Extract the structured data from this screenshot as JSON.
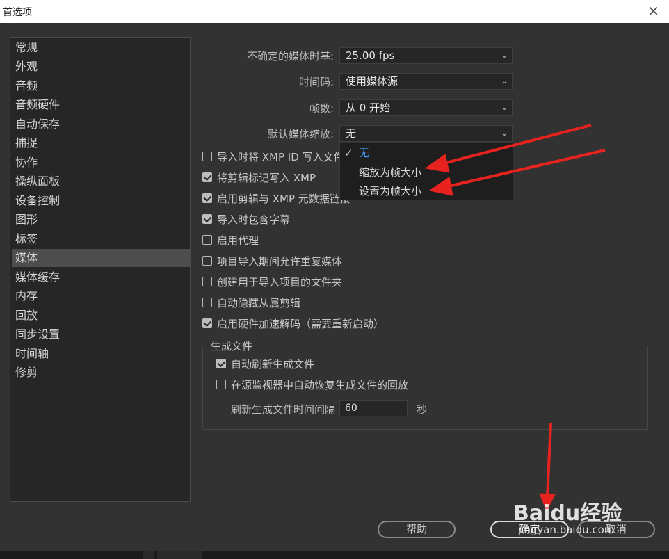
{
  "window": {
    "title": "首选项",
    "close_glyph": "✕"
  },
  "sidebar": {
    "items": [
      "常规",
      "外观",
      "音频",
      "音频硬件",
      "自动保存",
      "捕捉",
      "协作",
      "操纵面板",
      "设备控制",
      "图形",
      "标签",
      "媒体",
      "媒体缓存",
      "内存",
      "回放",
      "同步设置",
      "时间轴",
      "修剪"
    ],
    "selected": "媒体"
  },
  "media": {
    "timebase": {
      "label": "不确定的媒体时基:",
      "value": "25.00 fps"
    },
    "timecode": {
      "label": "时间码:",
      "value": "使用媒体源"
    },
    "frame_count": {
      "label": "帧数:",
      "value": "从 0 开始"
    },
    "default_scale": {
      "label": "默认媒体缩放:",
      "value": "无",
      "options": [
        "无",
        "缩放为帧大小",
        "设置为帧大小"
      ]
    },
    "checkboxes": [
      {
        "label": "导入时将 XMP ID 写入文件",
        "checked": false
      },
      {
        "label": "将剪辑标记写入 XMP",
        "checked": true
      },
      {
        "label": "启用剪辑与 XMP 元数据链接",
        "checked": true
      },
      {
        "label": "导入时包含字幕",
        "checked": true
      },
      {
        "label": "启用代理",
        "checked": false
      },
      {
        "label": "项目导入期间允许重复媒体",
        "checked": false
      },
      {
        "label": "创建用于导入项目的文件夹",
        "checked": false
      },
      {
        "label": "自动隐藏从属剪辑",
        "checked": false
      },
      {
        "label": "启用硬件加速解码（需要重新启动）",
        "checked": true
      }
    ],
    "generating_files": {
      "legend": "生成文件",
      "auto_refresh": {
        "label": "自动刷新生成文件",
        "checked": true
      },
      "restore_playback": {
        "label": "在源监视器中自动恢复生成文件的回放",
        "checked": false
      },
      "refresh_interval": {
        "label": "刷新生成文件时间间隔",
        "value": "60",
        "unit": "秒"
      }
    }
  },
  "buttons": {
    "help": "帮助",
    "ok": "确定",
    "cancel": "取消"
  },
  "watermark": {
    "brand": "Baidu经验",
    "url": "jingyan.baidu.com"
  },
  "colors": {
    "accent": "#4aa3ff",
    "annotation_arrow": "#e8231f"
  }
}
